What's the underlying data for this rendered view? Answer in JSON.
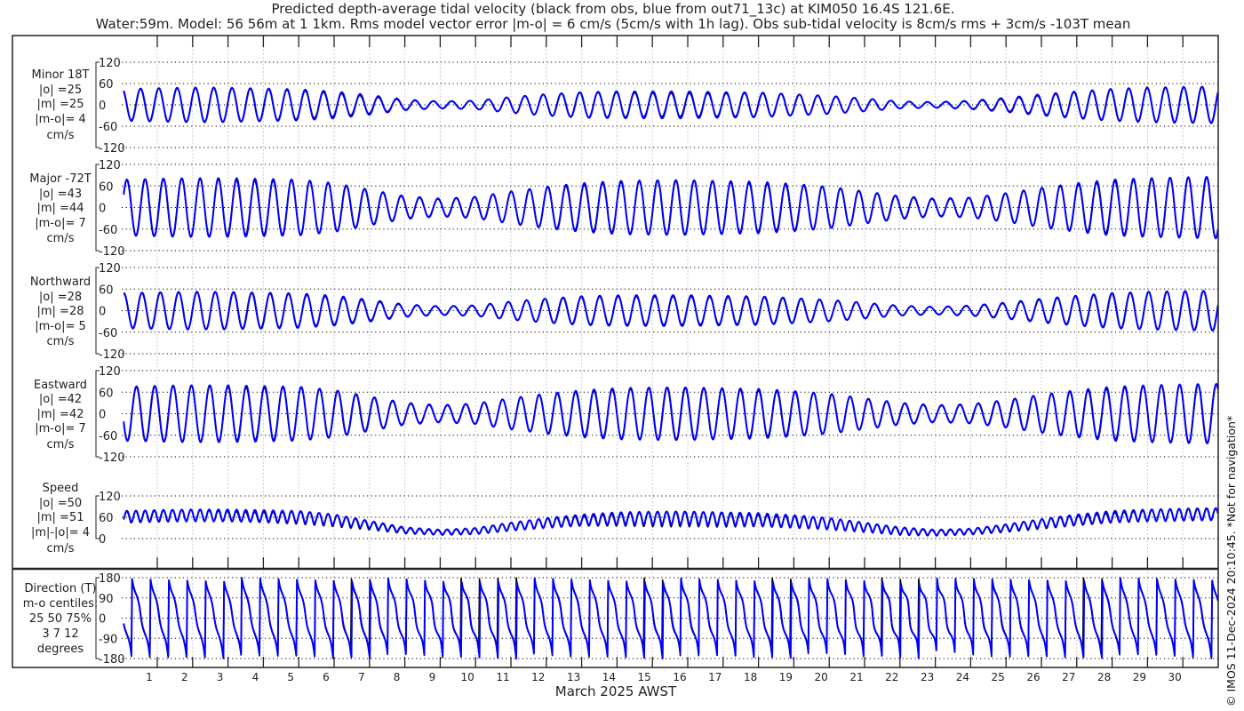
{
  "title_line1": "Predicted depth-average tidal velocity (black from obs, blue from out71_13c) at KIM050 16.4S 121.6E.",
  "title_line2": "Water:59m. Model: 56 56m at 1 1km. Rms model vector error |m-o| = 6 cm/s (5cm/s with 1h lag). Obs sub-tidal velocity is 8cm/s rms + 3cm/s -103T mean",
  "copyright": "© IMOS 11-Dec-2024 20:10:45. *Not for navigation*",
  "colors": {
    "obs": "#000000",
    "model": "#0000ff"
  },
  "chart_data": {
    "type": "line",
    "xlabel": "March 2025 AWST",
    "x_tick_labels": [
      "1",
      "2",
      "3",
      "4",
      "5",
      "6",
      "7",
      "8",
      "9",
      "10",
      "11",
      "12",
      "13",
      "14",
      "15",
      "16",
      "17",
      "18",
      "19",
      "20",
      "21",
      "22",
      "23",
      "24",
      "25",
      "26",
      "27",
      "28",
      "29",
      "30"
    ],
    "xlim_days": [
      0.05,
      31.0
    ],
    "tidal_period_days": 0.5175,
    "major_axis_direction_T": -72,
    "minor_axis_direction_T": 18,
    "envelope_day_boundaries": [
      0,
      1,
      2,
      3,
      4,
      5,
      6,
      7,
      8,
      9,
      10,
      11,
      12,
      13,
      14,
      15,
      16,
      17,
      18,
      19,
      20,
      21,
      22,
      23,
      24,
      25,
      26,
      27,
      28,
      29,
      30,
      31
    ],
    "major_amplitude_cms": [
      78,
      80,
      82,
      82,
      80,
      78,
      68,
      50,
      32,
      25,
      30,
      45,
      58,
      68,
      74,
      76,
      76,
      74,
      72,
      66,
      58,
      45,
      32,
      25,
      28,
      40,
      55,
      68,
      78,
      82,
      84,
      86
    ],
    "minor_amplitude_cms": [
      45,
      47,
      48,
      48,
      46,
      44,
      38,
      28,
      15,
      10,
      12,
      22,
      30,
      36,
      38,
      38,
      38,
      36,
      35,
      30,
      25,
      18,
      10,
      8,
      12,
      20,
      30,
      38,
      45,
      48,
      50,
      52
    ],
    "series": [
      {
        "name": "obs",
        "label": "black from obs"
      },
      {
        "name": "model",
        "label": "blue from out71_13c"
      }
    ],
    "panels": [
      {
        "key": "minor",
        "lines": [
          "Minor 18T",
          "|o| =25",
          "|m| =25",
          "|m-o|= 4",
          "cm/s"
        ],
        "ylim": [
          -120,
          120
        ],
        "yticks": [
          "120",
          "60",
          "0",
          "-60",
          "-120"
        ]
      },
      {
        "key": "major",
        "lines": [
          "Major -72T",
          "|o| =43",
          "|m| =44",
          "|m-o|= 7",
          "cm/s"
        ],
        "ylim": [
          -120,
          120
        ],
        "yticks": [
          "120",
          "60",
          "0",
          "-60",
          "-120"
        ]
      },
      {
        "key": "north",
        "lines": [
          "Northward",
          "|o| =28",
          "|m| =28",
          "|m-o|= 5",
          "cm/s"
        ],
        "ylim": [
          -120,
          120
        ],
        "yticks": [
          "120",
          "60",
          "0",
          "-60",
          "-120"
        ]
      },
      {
        "key": "east",
        "lines": [
          "Eastward",
          "|o| =42",
          "|m| =42",
          "|m-o|= 7",
          "cm/s"
        ],
        "ylim": [
          -120,
          120
        ],
        "yticks": [
          "120",
          "60",
          "0",
          "-60",
          "-120"
        ]
      },
      {
        "key": "speed",
        "lines": [
          "Speed",
          "|o| =50",
          "|m| =51",
          "|m|-|o|= 4",
          "cm/s"
        ],
        "ylim": [
          0,
          120
        ],
        "yticks": [
          "120",
          "60",
          "0"
        ]
      },
      {
        "key": "dir",
        "lines": [
          "Direction (T)",
          "m-o centiles:",
          "25  50  75%",
          "3   7  12",
          "degrees"
        ],
        "ylim": [
          -180,
          180
        ],
        "yticks": [
          "180",
          "90",
          "0",
          "-90",
          "-180"
        ]
      }
    ]
  }
}
